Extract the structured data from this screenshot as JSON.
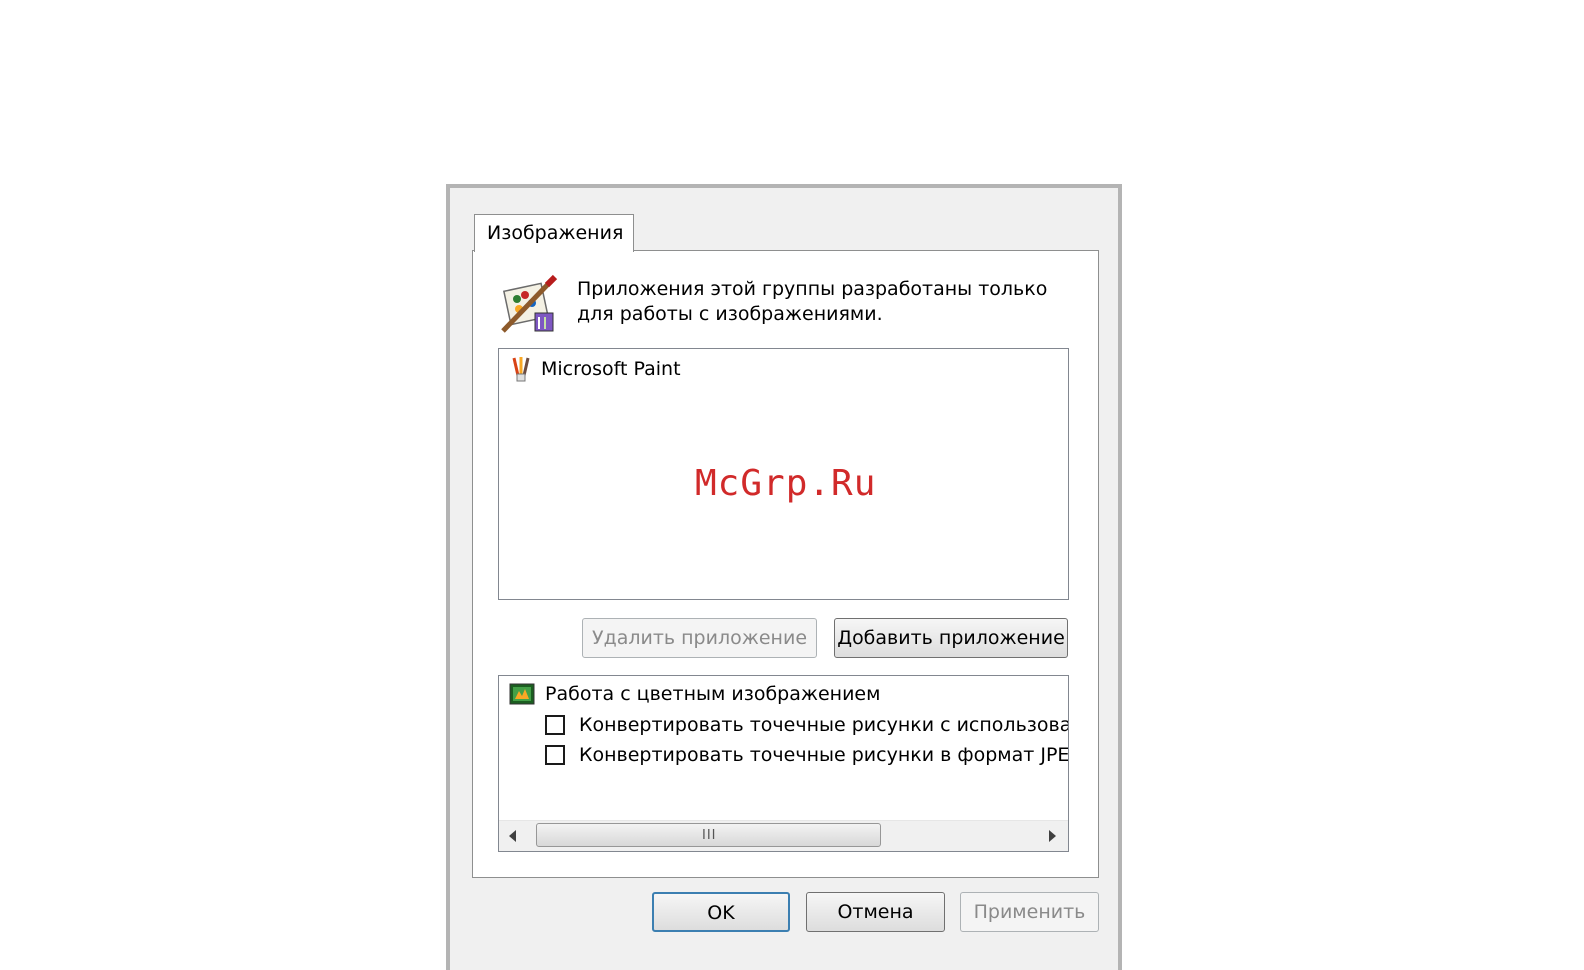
{
  "tab": {
    "label": "Изображения"
  },
  "description": {
    "line1": "Приложения этой группы разработаны только",
    "line2": "для работы с изображениями."
  },
  "app_list": {
    "items": [
      {
        "label": "Microsoft Paint",
        "icon": "paint-brushes-icon"
      }
    ]
  },
  "watermark": "McGrp.Ru",
  "buttons": {
    "remove_app": "Удалить приложение",
    "add_app": "Добавить приложение",
    "ok": "OK",
    "cancel": "Отмена",
    "apply": "Применить"
  },
  "options": {
    "group_label": "Работа с цветным изображением",
    "group_icon": "color-image-icon",
    "items": [
      {
        "label": "Конвертировать точечные рисунки с использован",
        "checked": false
      },
      {
        "label": "Конвертировать точечные рисунки в формат JPE",
        "checked": false
      }
    ],
    "scroll_grip": "III"
  },
  "colors": {
    "watermark": "#d12a2a",
    "default_button_border": "#3c7fb1"
  }
}
